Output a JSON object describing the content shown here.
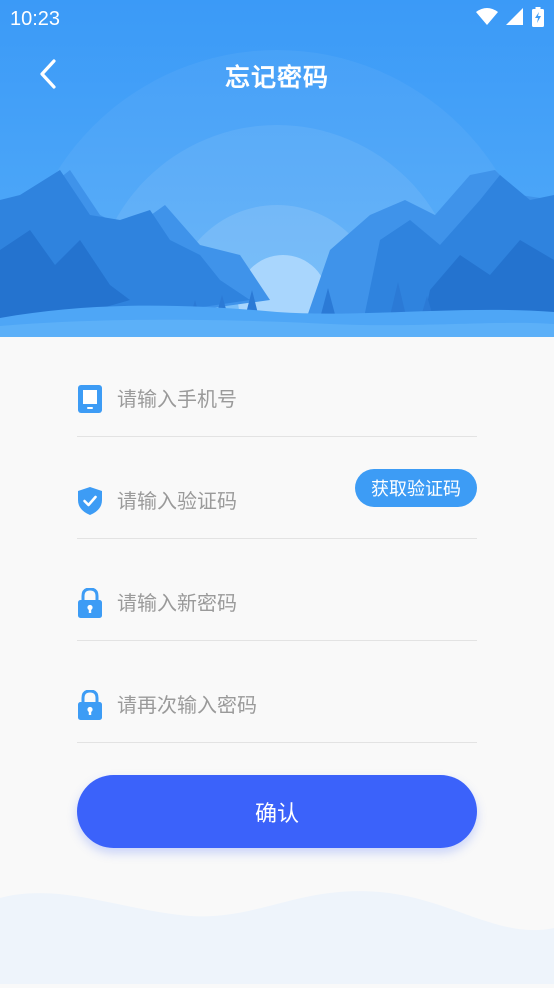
{
  "status_bar": {
    "time": "10:23"
  },
  "header": {
    "title": "忘记密码"
  },
  "form": {
    "phone_placeholder": "请输入手机号",
    "code_placeholder": "请输入验证码",
    "get_code_label": "获取验证码",
    "new_password_placeholder": "请输入新密码",
    "confirm_password_placeholder": "请再次输入密码"
  },
  "actions": {
    "confirm_label": "确认"
  },
  "colors": {
    "header_blue": "#3d9cf5",
    "button_blue": "#3b62fa",
    "icon_blue": "#3d9cf5"
  }
}
